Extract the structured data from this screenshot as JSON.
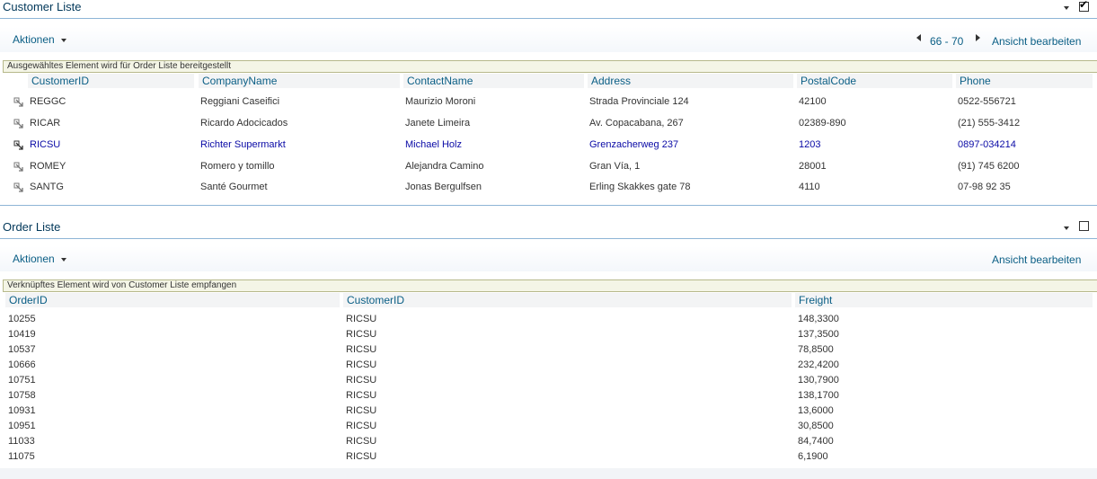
{
  "customer_part": {
    "title": "Customer Liste",
    "checkbox_checked": true,
    "check_glyph": "✔",
    "actions_label": "Aktionen",
    "paging_label": "66 - 70",
    "edit_view_label": "Ansicht bearbeiten",
    "connection_text": "Ausgewähltes Element wird für Order Liste bereitgestellt",
    "columns": [
      "CustomerID",
      "CompanyName",
      "ContactName",
      "Address",
      "PostalCode",
      "Phone"
    ],
    "rows": [
      {
        "id": "REGGC",
        "company": "Reggiani Caseifici",
        "contact": "Maurizio Moroni",
        "address": "Strada Provinciale 124",
        "postal": "42100",
        "phone": "0522-556721",
        "selected": false
      },
      {
        "id": "RICAR",
        "company": "Ricardo Adocicados",
        "contact": "Janete Limeira",
        "address": "Av. Copacabana, 267",
        "postal": "02389-890",
        "phone": "(21) 555-3412",
        "selected": false
      },
      {
        "id": "RICSU",
        "company": "Richter Supermarkt",
        "contact": "Michael Holz",
        "address": "Grenzacherweg 237",
        "postal": "1203",
        "phone": "0897-034214",
        "selected": true
      },
      {
        "id": "ROMEY",
        "company": "Romero y tomillo",
        "contact": "Alejandra Camino",
        "address": "Gran Vía, 1",
        "postal": "28001",
        "phone": "(91) 745 6200",
        "selected": false
      },
      {
        "id": "SANTG",
        "company": "Santé Gourmet",
        "contact": "Jonas Bergulfsen",
        "address": "Erling Skakkes gate 78",
        "postal": "4110",
        "phone": "07-98 92 35",
        "selected": false
      }
    ]
  },
  "order_part": {
    "title": "Order Liste",
    "checkbox_checked": false,
    "actions_label": "Aktionen",
    "edit_view_label": "Ansicht bearbeiten",
    "connection_text": "Verknüpftes Element wird von Customer Liste empfangen",
    "columns": [
      "OrderID",
      "CustomerID",
      "Freight"
    ],
    "rows": [
      {
        "order_id": "10255",
        "customer_id": "RICSU",
        "freight": "148,3300"
      },
      {
        "order_id": "10419",
        "customer_id": "RICSU",
        "freight": "137,3500"
      },
      {
        "order_id": "10537",
        "customer_id": "RICSU",
        "freight": "78,8500"
      },
      {
        "order_id": "10666",
        "customer_id": "RICSU",
        "freight": "232,4200"
      },
      {
        "order_id": "10751",
        "customer_id": "RICSU",
        "freight": "130,7900"
      },
      {
        "order_id": "10758",
        "customer_id": "RICSU",
        "freight": "138,1700"
      },
      {
        "order_id": "10931",
        "customer_id": "RICSU",
        "freight": "13,6000"
      },
      {
        "order_id": "10951",
        "customer_id": "RICSU",
        "freight": "30,8500"
      },
      {
        "order_id": "11033",
        "customer_id": "RICSU",
        "freight": "84,7400"
      },
      {
        "order_id": "11075",
        "customer_id": "RICSU",
        "freight": "6,1900"
      }
    ]
  },
  "colors": {
    "link": "#0a5e85",
    "selected_row_text": "#0a0aa6",
    "title_rule": "#8eb5d6",
    "connection_bar_bg": "#f4f5e6"
  },
  "icons": {
    "row_select": "select-connection-icon",
    "menu_chevron": "chevron-down-icon",
    "paging_prev": "triangle-left-icon",
    "paging_next": "triangle-right-icon"
  }
}
